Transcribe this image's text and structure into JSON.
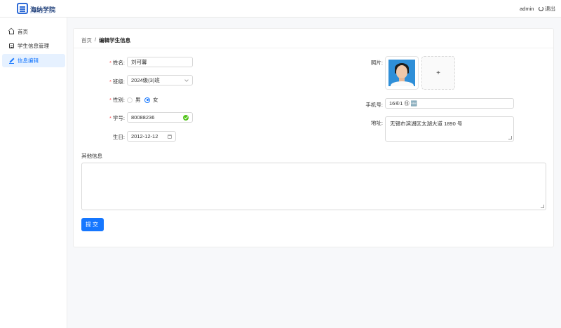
{
  "header": {
    "brand": "海纳学院",
    "user": "admin",
    "logout_label": "退出"
  },
  "sidebar": {
    "items": [
      {
        "label": "首页",
        "icon": "home-icon"
      },
      {
        "label": "学生信息管理",
        "icon": "document-icon"
      },
      {
        "label": "信息编辑",
        "icon": "edit-icon",
        "active": true
      }
    ]
  },
  "breadcrumb": {
    "home": "首页",
    "separator": "/",
    "current": "编辑学生信息"
  },
  "form": {
    "name": {
      "label": "姓名:",
      "value": "刘可馨"
    },
    "class": {
      "label": "班级:",
      "value": "2024级(3)班"
    },
    "gender": {
      "label": "性别:",
      "options": [
        "男",
        "女"
      ],
      "selected": "女"
    },
    "student_id": {
      "label": "学号:",
      "value": "80088236"
    },
    "birthday": {
      "label": "生日:",
      "value": "2012-12-12"
    },
    "photo": {
      "label": "照片:",
      "upload_symbol": "+"
    },
    "phone": {
      "label": "手机号:",
      "value": "16⑥1 ⑮ 🆕"
    },
    "address": {
      "label": "地址:",
      "value": "无锡市滨湖区太湖大道 1890 号"
    },
    "other": {
      "label": "其他信息",
      "value": ""
    },
    "submit_label": "提交"
  },
  "colors": {
    "primary": "#1677ff",
    "required": "#ff4d4f",
    "success": "#52c41a"
  }
}
